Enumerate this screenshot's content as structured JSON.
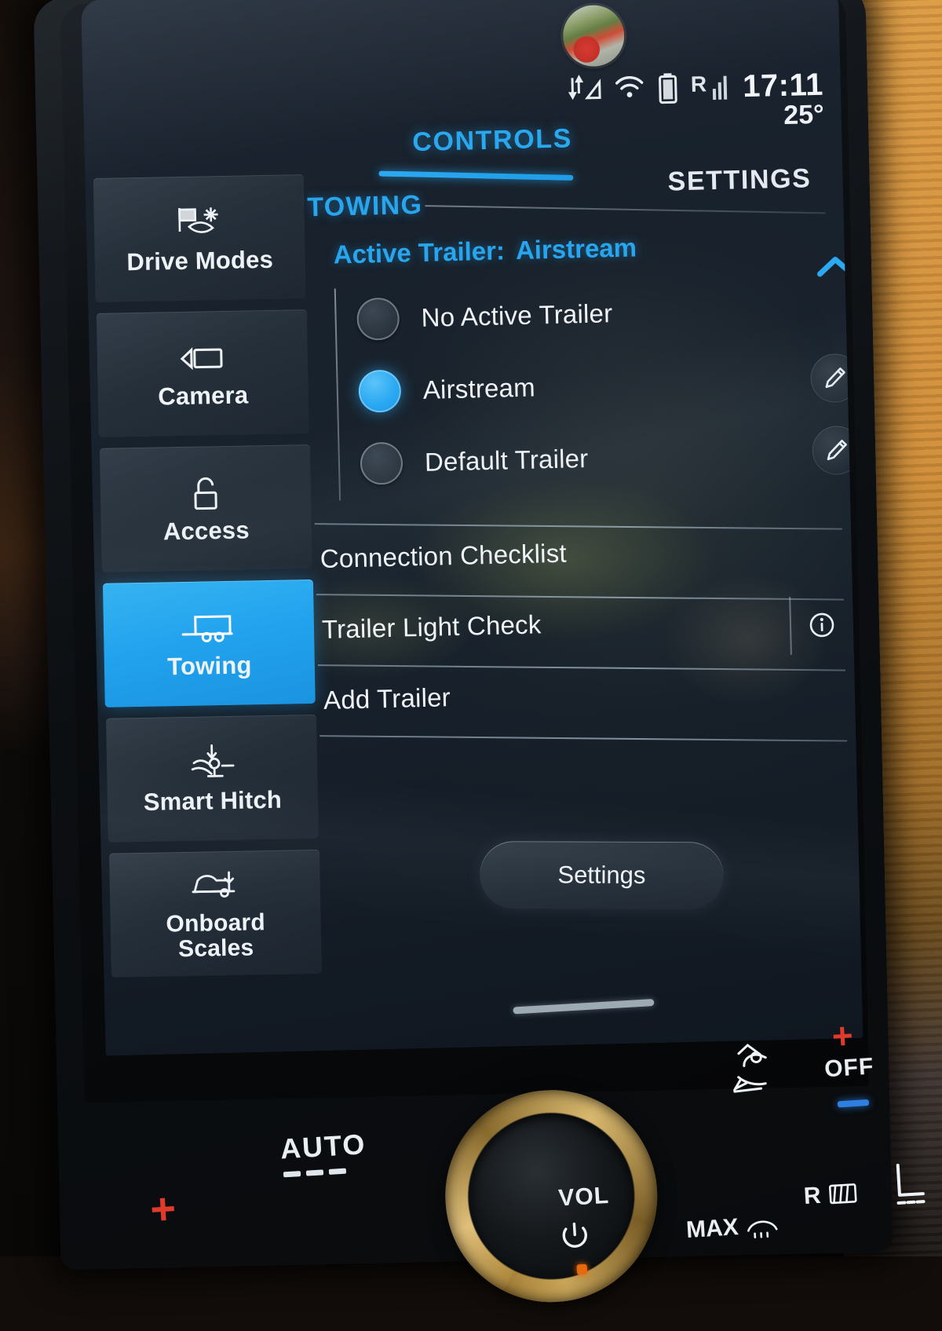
{
  "device": {
    "label": "vehicle-infotainment-head-unit",
    "accent_color": "#29a7ef",
    "screen_bg": "#18222d"
  },
  "status_bar": {
    "data_icon": "data-transfer-icon",
    "nav_icon": "navigation-arrow-icon",
    "wifi_icon": "wifi-icon",
    "battery_icon": "battery-icon",
    "signal_label": "R",
    "signal_icon": "signal-bars-icon",
    "clock": "17:11",
    "temperature": "25°"
  },
  "avatar": {
    "name": "user-profile-photo"
  },
  "tabs": [
    {
      "label": "CONTROLS",
      "active": true
    },
    {
      "label": "SETTINGS",
      "active": false
    }
  ],
  "sidebar": {
    "items": [
      {
        "label": "Drive Modes",
        "icon": "drive-modes-icon",
        "active": false
      },
      {
        "label": "Camera",
        "icon": "camera-icon",
        "active": false
      },
      {
        "label": "Access",
        "icon": "unlock-padlock-icon",
        "active": false
      },
      {
        "label": "Towing",
        "icon": "trailer-icon",
        "active": true
      },
      {
        "label": "Smart Hitch",
        "icon": "smart-hitch-icon",
        "active": false
      },
      {
        "label": "Onboard Scales",
        "icon": "onboard-scales-icon",
        "active": false,
        "line1": "Onboard",
        "line2": "Scales"
      }
    ]
  },
  "main": {
    "section_title": "TOWING",
    "active_trailer_label": "Active Trailer:",
    "active_trailer_value": "Airstream",
    "collapse_icon": "chevron-up-icon",
    "trailer_options": [
      {
        "label": "No Active Trailer",
        "selected": false,
        "editable": false
      },
      {
        "label": "Airstream",
        "selected": true,
        "editable": true
      },
      {
        "label": "Default Trailer",
        "selected": false,
        "editable": true
      }
    ],
    "rows": [
      {
        "label": "Connection Checklist",
        "info": false
      },
      {
        "label": "Trailer Light Check",
        "info": true,
        "info_icon": "info-icon"
      },
      {
        "label": "Add Trailer",
        "info": false
      }
    ],
    "settings_button": "Settings",
    "home_indicator": "home-indicator-bar"
  },
  "hvac": {
    "plus_left": "+",
    "auto": "AUTO",
    "volume_label": "VOL",
    "power_icon": "power-icon",
    "max_defrost": "MAX",
    "rear_defrost": "R",
    "heated_seat_icon": "heated-seat-icon",
    "seat_position_icon": "seat-position-icon",
    "temp_up": "+",
    "temp_off": "OFF",
    "temp_down": "−"
  }
}
